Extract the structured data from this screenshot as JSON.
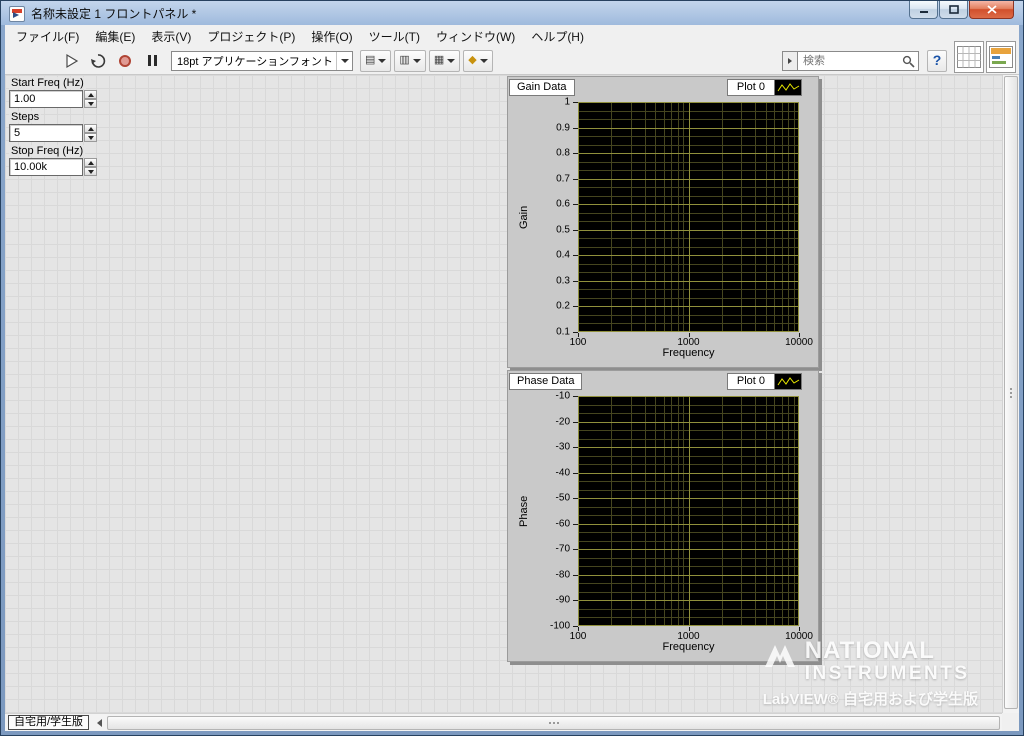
{
  "window": {
    "title": "名称未設定 1 フロントパネル *"
  },
  "menubar": {
    "items": [
      {
        "name": "file",
        "label": "ファイル(F)"
      },
      {
        "name": "edit",
        "label": "編集(E)"
      },
      {
        "name": "view",
        "label": "表示(V)"
      },
      {
        "name": "project",
        "label": "プロジェクト(P)"
      },
      {
        "name": "operate",
        "label": "操作(O)"
      },
      {
        "name": "tools",
        "label": "ツール(T)"
      },
      {
        "name": "window",
        "label": "ウィンドウ(W)"
      },
      {
        "name": "help",
        "label": "ヘルプ(H)"
      }
    ]
  },
  "toolbar": {
    "font_selector": "18pt アプリケーションフォント",
    "search_placeholder": "検索"
  },
  "panel": {
    "controls": [
      {
        "label": "Start Freq (Hz)",
        "value": "1.00"
      },
      {
        "label": "Steps",
        "value": "5"
      },
      {
        "label": "Stop Freq (Hz)",
        "value": "10.00k"
      }
    ]
  },
  "chart_data": [
    {
      "type": "line",
      "title": "Gain Data",
      "legend": [
        {
          "label": "Plot 0",
          "color": "#e6e600"
        }
      ],
      "legend_position": "top-right",
      "xlabel": "Frequency",
      "ylabel": "Gain",
      "xscale": "log",
      "xlim": [
        100,
        10000
      ],
      "xticks": [
        100,
        1000,
        10000
      ],
      "ylim": [
        0.1,
        1
      ],
      "yticks": [
        1,
        0.9,
        0.8,
        0.7,
        0.6,
        0.5,
        0.4,
        0.3,
        0.2,
        0.1
      ],
      "grid": true,
      "plot_bg": "#000000",
      "grid_major_color": "#90903c",
      "grid_minor_color": "#45451f",
      "series": [
        {
          "name": "Plot 0",
          "x": [],
          "y": []
        }
      ]
    },
    {
      "type": "line",
      "title": "Phase Data",
      "legend": [
        {
          "label": "Plot 0",
          "color": "#e6e600"
        }
      ],
      "legend_position": "top-right",
      "xlabel": "Frequency",
      "ylabel": "Phase",
      "xscale": "log",
      "xlim": [
        100,
        10000
      ],
      "xticks": [
        100,
        1000,
        10000
      ],
      "ylim": [
        -100,
        -10
      ],
      "yticks": [
        -10,
        -20,
        -30,
        -40,
        -50,
        -60,
        -70,
        -80,
        -90,
        -100
      ],
      "grid": true,
      "plot_bg": "#000000",
      "grid_major_color": "#90903c",
      "grid_minor_color": "#45451f",
      "series": [
        {
          "name": "Plot 0",
          "x": [],
          "y": []
        }
      ]
    }
  ],
  "watermark": {
    "brand_line1": "NATIONAL",
    "brand_line2": "INSTRUMENTS",
    "edition": "LabVIEW® 自宅用および学生版"
  },
  "statusbar": {
    "edition_tab": "自宅用/学生版"
  }
}
